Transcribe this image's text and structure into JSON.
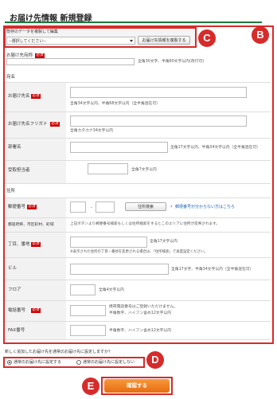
{
  "title": "お届け先情報 新規登録",
  "copy": {
    "label": "既存のデータを複製して編集",
    "select_value": "--選択してください--",
    "button": "お届け先情報を複製する"
  },
  "required": "必須",
  "recipient": {
    "label": "お届け先宛称",
    "note": "全角30文字、半角60文字以内(改行可)"
  },
  "section_name": "宛名",
  "name": {
    "label": "お届け先名",
    "note": "全角34文字以内、半角68文字以内（全半角混在可）"
  },
  "kana": {
    "label": "お届け先名フリガナ",
    "note": "全角カタカナ34文字以内"
  },
  "dept": {
    "label": "部署名",
    "note": "全角17文字以内、半角34文字以内（全半角混在可）"
  },
  "contact": {
    "label": "受取担当者",
    "note": "全角7文字以内"
  },
  "section_address": "住所",
  "postal": {
    "label": "郵便番号",
    "dash": "-",
    "search_button": "住所検索",
    "link": "郵便番号が分からない方はこちら",
    "arrow": "›"
  },
  "pref": {
    "label": "都道府県、市区町村、町域",
    "note": "上記ボタンより郵便番号検索もしくは住所検索をするとこのエリアに住所が反映されます。"
  },
  "street": {
    "label": "丁目、番地",
    "note": "全角17文字以内",
    "note2": "※表示された住所の丁目・番地を変更される場合は、「住所検索」で再度設定ください。"
  },
  "building": {
    "label": "ビル",
    "note": "全角17文字、半角34文字以内（全半角混在可）"
  },
  "floor": {
    "label": "フロア",
    "note": "全角4文字以内"
  },
  "phone": {
    "label": "電話番号",
    "note1": "携帯電話番号はご登録いただけません。",
    "note2": "半角数字、ハイフン含め12文字以内"
  },
  "fax": {
    "label": "FAX番号",
    "note": "半角数字、ハイフン含め12文字以内"
  },
  "default": {
    "question": "新しく追加したお届け先を通常のお届け先に設定しますか？",
    "option_yes": "通常のお届け先に設定する",
    "option_no": "通常のお届け先に設定しない"
  },
  "confirm_button": "確認する",
  "badges": {
    "b": "B",
    "c": "C",
    "d": "D",
    "e": "E"
  },
  "colors": {
    "accent": "#d62b2b",
    "header_green": "#1a7a3a",
    "button_orange": "#f07a1e"
  }
}
